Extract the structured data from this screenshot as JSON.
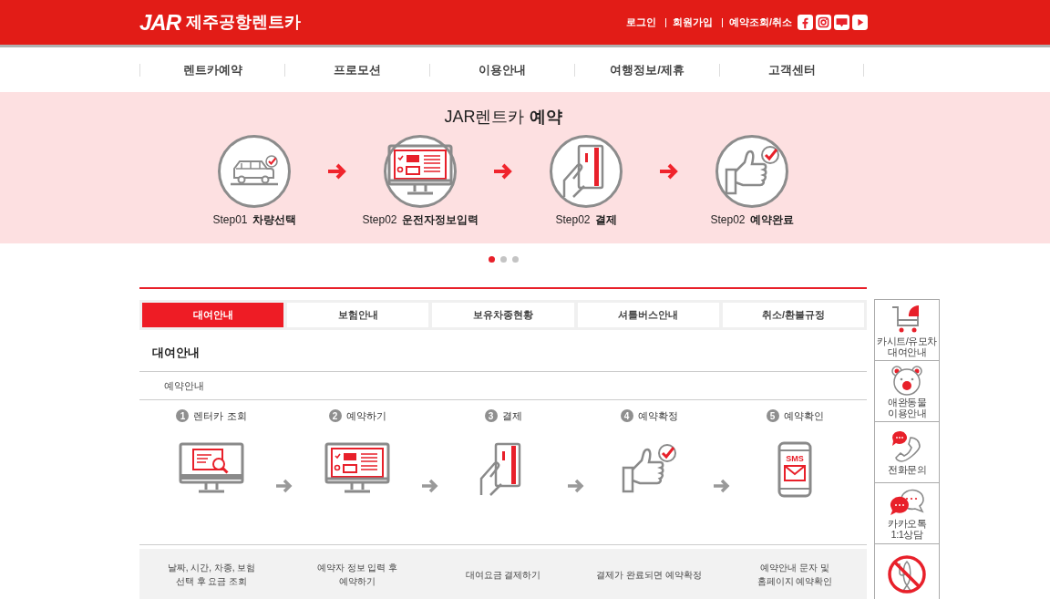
{
  "header": {
    "logo_mark": "JAR",
    "logo_text": "제주공항렌트카",
    "links": [
      "로그인",
      "회원가입",
      "예약조회/취소"
    ],
    "social": [
      {
        "kind": "facebook"
      },
      {
        "kind": "instagram"
      },
      {
        "kind": "blog"
      },
      {
        "kind": "youtube"
      }
    ]
  },
  "nav": [
    "렌트카예약",
    "프로모션",
    "이용안내",
    "여행정보/제휴",
    "고객센터"
  ],
  "banner": {
    "title": "JAR렌트카 **예약**",
    "steps": [
      {
        "kind": "car",
        "step": "Step01",
        "label": "차량선택"
      },
      {
        "kind": "form",
        "step": "Step02",
        "label": "운전자정보입력"
      },
      {
        "kind": "card",
        "step": "Step02",
        "label": "결제"
      },
      {
        "kind": "thumb",
        "step": "Step02",
        "label": "예약완료"
      }
    ],
    "dots": [
      {
        "selected": true
      },
      {
        "selected": false
      },
      {
        "selected": false
      }
    ]
  },
  "tabs": [
    {
      "label": "대여안내",
      "selected": true
    },
    {
      "label": "보험안내",
      "selected": false
    },
    {
      "label": "보유차종현황",
      "selected": false
    },
    {
      "label": "셔틀버스안내",
      "selected": false
    },
    {
      "label": "취소/환불규정",
      "selected": false
    }
  ],
  "section_title": "대여안내",
  "sub_title": "예약안내",
  "process": [
    {
      "number": "1",
      "title": "렌터카 조회",
      "kind": "search",
      "description": "날짜, 시간, 차종, 보험\n선택 후 요금 조회"
    },
    {
      "number": "2",
      "title": "예약하기",
      "kind": "form",
      "description": "예약자 정보 입력 후\n예약하기"
    },
    {
      "number": "3",
      "title": "결제",
      "kind": "card",
      "description": "대여요금 결제하기"
    },
    {
      "number": "4",
      "title": "예약확정",
      "kind": "thumb",
      "description": "결제가 완료되면 예약확정"
    },
    {
      "number": "5",
      "title": "예약확인",
      "kind": "sms",
      "icon_text": "SMS",
      "description": "예약안내 문자 및\n홈페이지 예약확인"
    }
  ],
  "quick_menu": [
    {
      "kind": "stroller",
      "label": "카시트/유모차\n대여안내"
    },
    {
      "kind": "bear",
      "label": "애완동물\n이용안내"
    },
    {
      "kind": "phone",
      "label": "전화문의"
    },
    {
      "kind": "chat",
      "label": "카카오톡\n1:1상담"
    },
    {
      "kind": "nopet"
    }
  ]
}
